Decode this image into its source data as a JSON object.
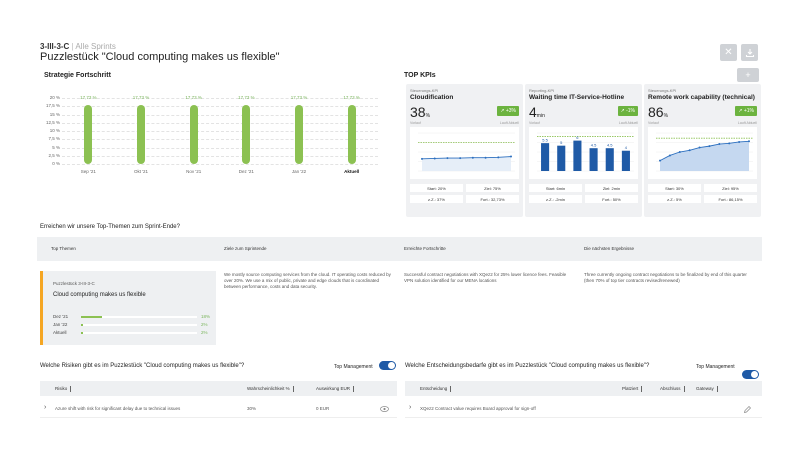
{
  "header": {
    "code": "3-III-3-C",
    "separator": "|",
    "subtitle": "Alle Sprints",
    "title": "Puzzlestück \"Cloud computing makes us flexible\""
  },
  "strategy": {
    "title": "Strategie Fortschritt",
    "y_ticks": [
      "20 %",
      "17,5 %",
      "15 %",
      "12,5 %",
      "10 %",
      "7,5 %",
      "5 %",
      "2,5 %",
      "0 %"
    ]
  },
  "chart_data": {
    "type": "bar",
    "categories": [
      "Sep '21",
      "Okt '21",
      "Nov '21",
      "Dez '21",
      "Jan '22",
      "Aktuell"
    ],
    "values": [
      17.73,
      17.73,
      17.73,
      17.73,
      17.73,
      17.73
    ],
    "value_labels": [
      "17,73 %",
      "17,73 %",
      "17,73 %",
      "17,73 %",
      "17,73 %",
      "17,73 %"
    ],
    "ylim": [
      0,
      20
    ],
    "bar_color": "#8cc152"
  },
  "kpis": {
    "title": "TOP KPIs",
    "add_label": "+",
    "cards": [
      {
        "type": "Steuerungs-KPI",
        "name": "Cloudification",
        "value": "38",
        "unit": "%",
        "badge": "+3%",
        "sub": "Lauft Aktuell",
        "prev": "Vorlauf",
        "chart_type": "line",
        "chart_values": [
          32,
          33,
          34,
          34,
          35,
          35,
          36,
          38
        ],
        "target_line": 75,
        "ymax": 100,
        "start": "Start: 20%",
        "ziel": "Ziel: 75%",
        "sz": "z.Z.: 37%",
        "fort": "Fort.: 32,73%"
      },
      {
        "type": "Reporting-KPI",
        "name": "Waiting time IT-Service-Hotline",
        "value": "4",
        "unit": "min",
        "badge": "-1%",
        "sub": "Lauft Aktuell",
        "prev": "Vorlauf",
        "chart_type": "bar",
        "chart_values": [
          5.5,
          5,
          6,
          4.5,
          4.5,
          4
        ],
        "chart_labels": [
          "5.5",
          "5",
          "6",
          "4.5",
          "4.5",
          "4"
        ],
        "target_line": 6.8,
        "ymax": 7.5,
        "start": "Start: 6min",
        "ziel": "Ziel: 2min",
        "sz": "z.Z.: -2min",
        "fort": "Fort.: 50%"
      },
      {
        "type": "Steuerungs-KPI",
        "name": "Remote work capability (technical)",
        "value": "86",
        "unit": "%",
        "badge": "+1%",
        "sub": "Lauft Aktuell",
        "prev": "Vorlauf",
        "chart_type": "area",
        "chart_values": [
          30,
          45,
          55,
          60,
          68,
          72,
          78,
          80,
          84,
          86
        ],
        "target_line": 95,
        "ymax": 110,
        "start": "Start: 30%",
        "ziel": "Ziel: 95%",
        "sz": "z.Z.: 5%",
        "fort": "Fort.: 86,15%"
      }
    ]
  },
  "topics": {
    "question": "Erreichen wir unsere Top-Themen zum Sprint-Ende?",
    "headers": [
      "Top Themen",
      "Ziele zum Sprintende",
      "Erreichte Fortschritte",
      "Die nächsten Ergebnisse"
    ],
    "card_code": "Puzzlestück 3-III-3-C",
    "card_title": "Cloud computing makes us flexible",
    "progress": [
      {
        "label": "Dez '21",
        "value": 18,
        "text": "18%"
      },
      {
        "label": "Jan '22",
        "value": 2,
        "text": "2%"
      },
      {
        "label": "Aktuell",
        "value": 2,
        "text": "2%"
      }
    ],
    "goal": "We mostly source computing services from the cloud. IT operating costs reduced by over 20%. We use a mix of public, private and edge clouds that is coordinated between performance, costs and data security.",
    "achieved": "Successful contract negotiations with XQez2 for 25% lower licence fees. Feasible VPN solution identified for our MENA locations",
    "next": "Three currently ongoing contract negotiations to be finalized by end of this quarter (then 70% of top tier contracts revised/renewed)"
  },
  "risks": {
    "question": "Welche Risiken gibt es im Puzzlestück \"Cloud computing makes us flexible\"?",
    "toggle_label": "Top Management",
    "headers": [
      "Risiko",
      "Wahrscheinlichkeit %",
      "Auswirkung EUR"
    ],
    "rows": [
      {
        "name": "Azure shift with risk for significant delay due to technical issues",
        "prob": "30%",
        "impact": "0 EUR"
      }
    ]
  },
  "decisions": {
    "question": "Welche Entscheidungsbedarfe gibt es im Puzzlestück \"Cloud computing makes us flexible\"?",
    "toggle_label": "Top Management",
    "headers": [
      "Entscheidung",
      "Platziert",
      "Abschluss",
      "Gateway"
    ],
    "rows": [
      {
        "name": "XQez2 Contract value requires Board approval for sign-off"
      }
    ]
  }
}
